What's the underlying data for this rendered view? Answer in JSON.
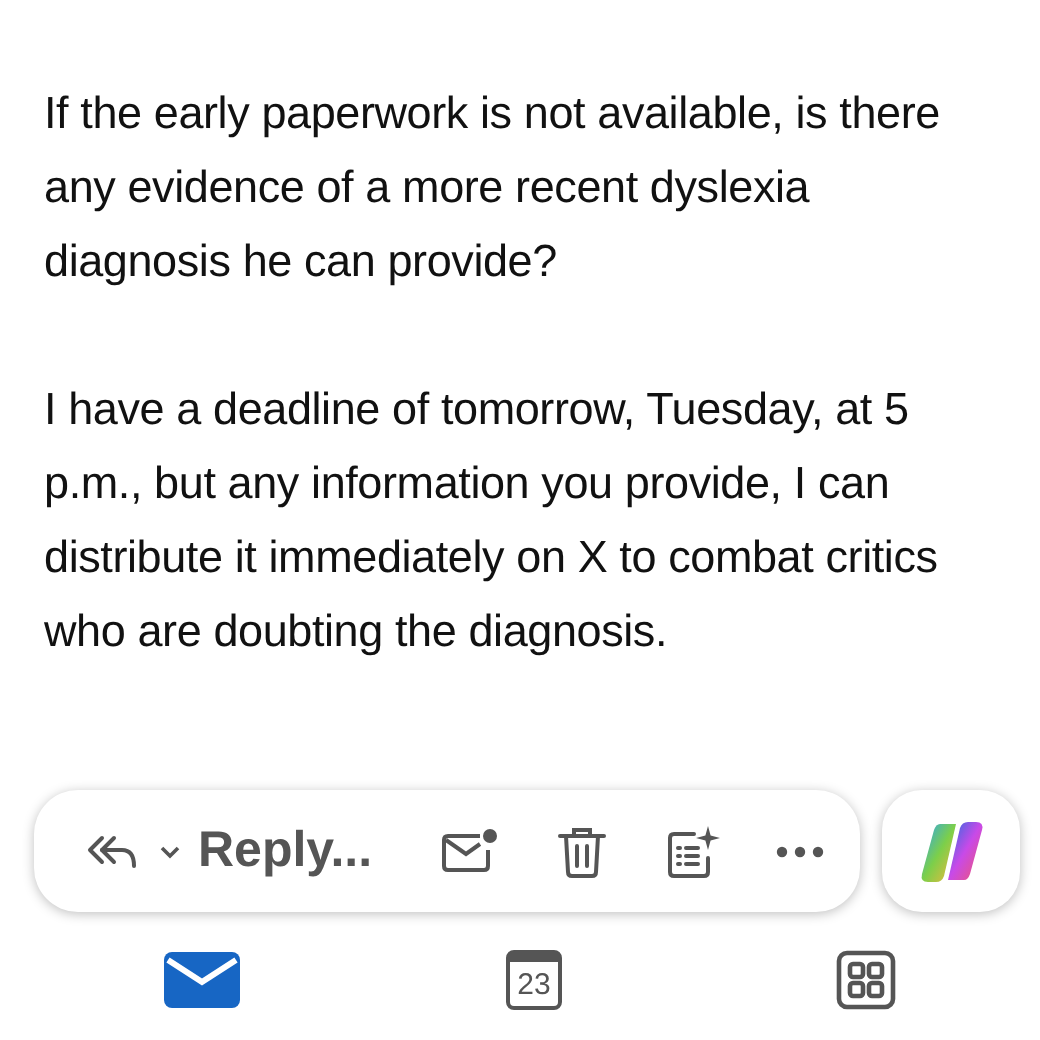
{
  "message": {
    "paragraphs": [
      "If the early paperwork is not available, is there any evidence of a more recent dyslexia diagnosis he can provide?",
      "I have a deadline of tomorrow, Tuesday, at 5 p.m., but any information you provide, I can distribute it immediately on X to combat critics who are doubting the diagnosis."
    ]
  },
  "action_bar": {
    "reply_label": "Reply..."
  },
  "tabs": [
    {
      "kind": "mail",
      "selected": true
    },
    {
      "kind": "calendar",
      "selected": false,
      "day": "23"
    },
    {
      "kind": "apps",
      "selected": false
    }
  ]
}
